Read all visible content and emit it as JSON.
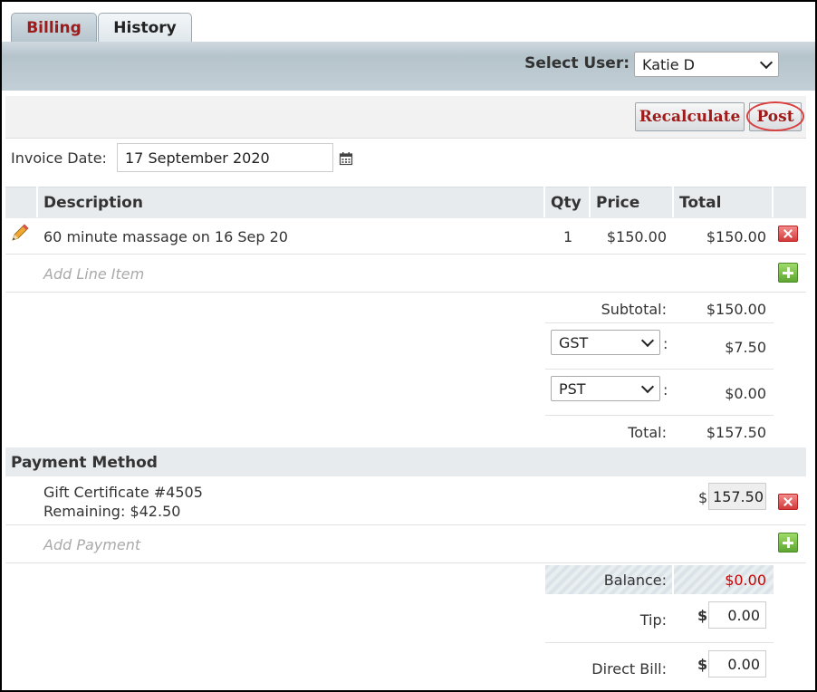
{
  "tabs": [
    {
      "label": "Billing"
    },
    {
      "label": "History"
    }
  ],
  "header": {
    "select_user_label": "Select User:",
    "selected_user": "Katie D"
  },
  "actions": {
    "recalculate": "Recalculate",
    "post": "Post"
  },
  "invoice": {
    "date_label": "Invoice Date:",
    "date_value": "17 September 2020"
  },
  "table": {
    "headers": {
      "description": "Description",
      "qty": "Qty",
      "price": "Price",
      "total": "Total"
    },
    "rows": [
      {
        "description": "60 minute massage on 16 Sep 20",
        "qty": "1",
        "price": "$150.00",
        "total": "$150.00"
      }
    ],
    "add_line_item": "Add Line Item"
  },
  "totals": {
    "subtotal_label": "Subtotal:",
    "subtotal_value": "$150.00",
    "tax1_name": "GST",
    "tax1_suffix": ":",
    "tax1_value": "$7.50",
    "tax2_name": "PST",
    "tax2_suffix": ":",
    "tax2_value": "$0.00",
    "total_label": "Total:",
    "total_value": "$157.50"
  },
  "payment": {
    "section_title": "Payment Method",
    "items": [
      {
        "name": "Gift Certificate #4505",
        "remaining": "Remaining: $42.50",
        "currency": "$",
        "amount": "157.50"
      }
    ],
    "add_payment": "Add Payment"
  },
  "summary": {
    "balance_label": "Balance:",
    "balance_value": "$0.00",
    "tip_label": "Tip:",
    "tip_currency": "$",
    "tip_value": "0.00",
    "direct_bill_label": "Direct Bill:",
    "direct_bill_currency": "$",
    "direct_bill_value": "0.00"
  },
  "colors": {
    "accent_red": "#a01a1a",
    "balance_red": "#cc0000",
    "header_bg": "#c3cfd6"
  }
}
